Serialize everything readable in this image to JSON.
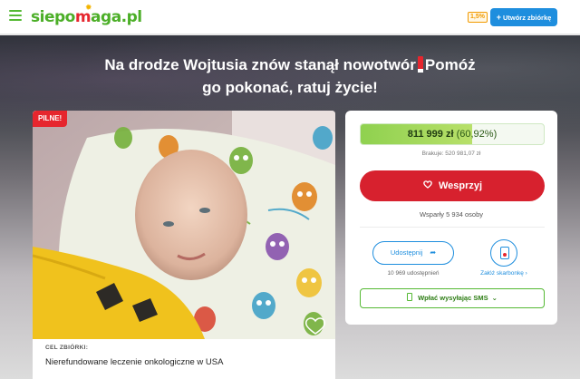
{
  "header": {
    "logo_parts": [
      "siepo",
      "m",
      "aga.pl"
    ],
    "percent_badge": "1,5%",
    "create_button": "Utwórz zbiórkę",
    "create_plus": "+"
  },
  "headline": {
    "line1_a": "Na drodze Wojtusia znów stanął nowotwór",
    "line1_b": "Pomóż",
    "line2": "go pokonać, ratuj życie!"
  },
  "campaign": {
    "badge": "PILNE!",
    "goal_label": "CEL ZBIÓRKI:",
    "goal_text": "Nierefundowane leczenie onkologiczne w USA"
  },
  "donation": {
    "amount": "811 999 zł",
    "percent": "(60,92%)",
    "progress_fraction": 0.6092,
    "missing": "Brakuje: 520 981,07 zł",
    "donate_label": "Wesprzyj",
    "supporters": "Wsparły 5 934 osoby",
    "share_label": "Udostępnij",
    "share_count": "10 969 udostępnień",
    "piggy_label": "Załóż skarbonkę",
    "piggy_chevron": "›",
    "sms_label": "Wpłać wysyłając SMS",
    "sms_chevron": "⌄"
  },
  "colors": {
    "brand_green": "#55b934",
    "brand_red": "#d7212e",
    "accent_blue": "#1e8ede"
  },
  "icons": {
    "menu": "hamburger-icon",
    "heart_hand": "heart-hand-icon",
    "share": "share-arrow-icon",
    "piggy": "piggy-bank-icon",
    "phone": "phone-icon"
  }
}
